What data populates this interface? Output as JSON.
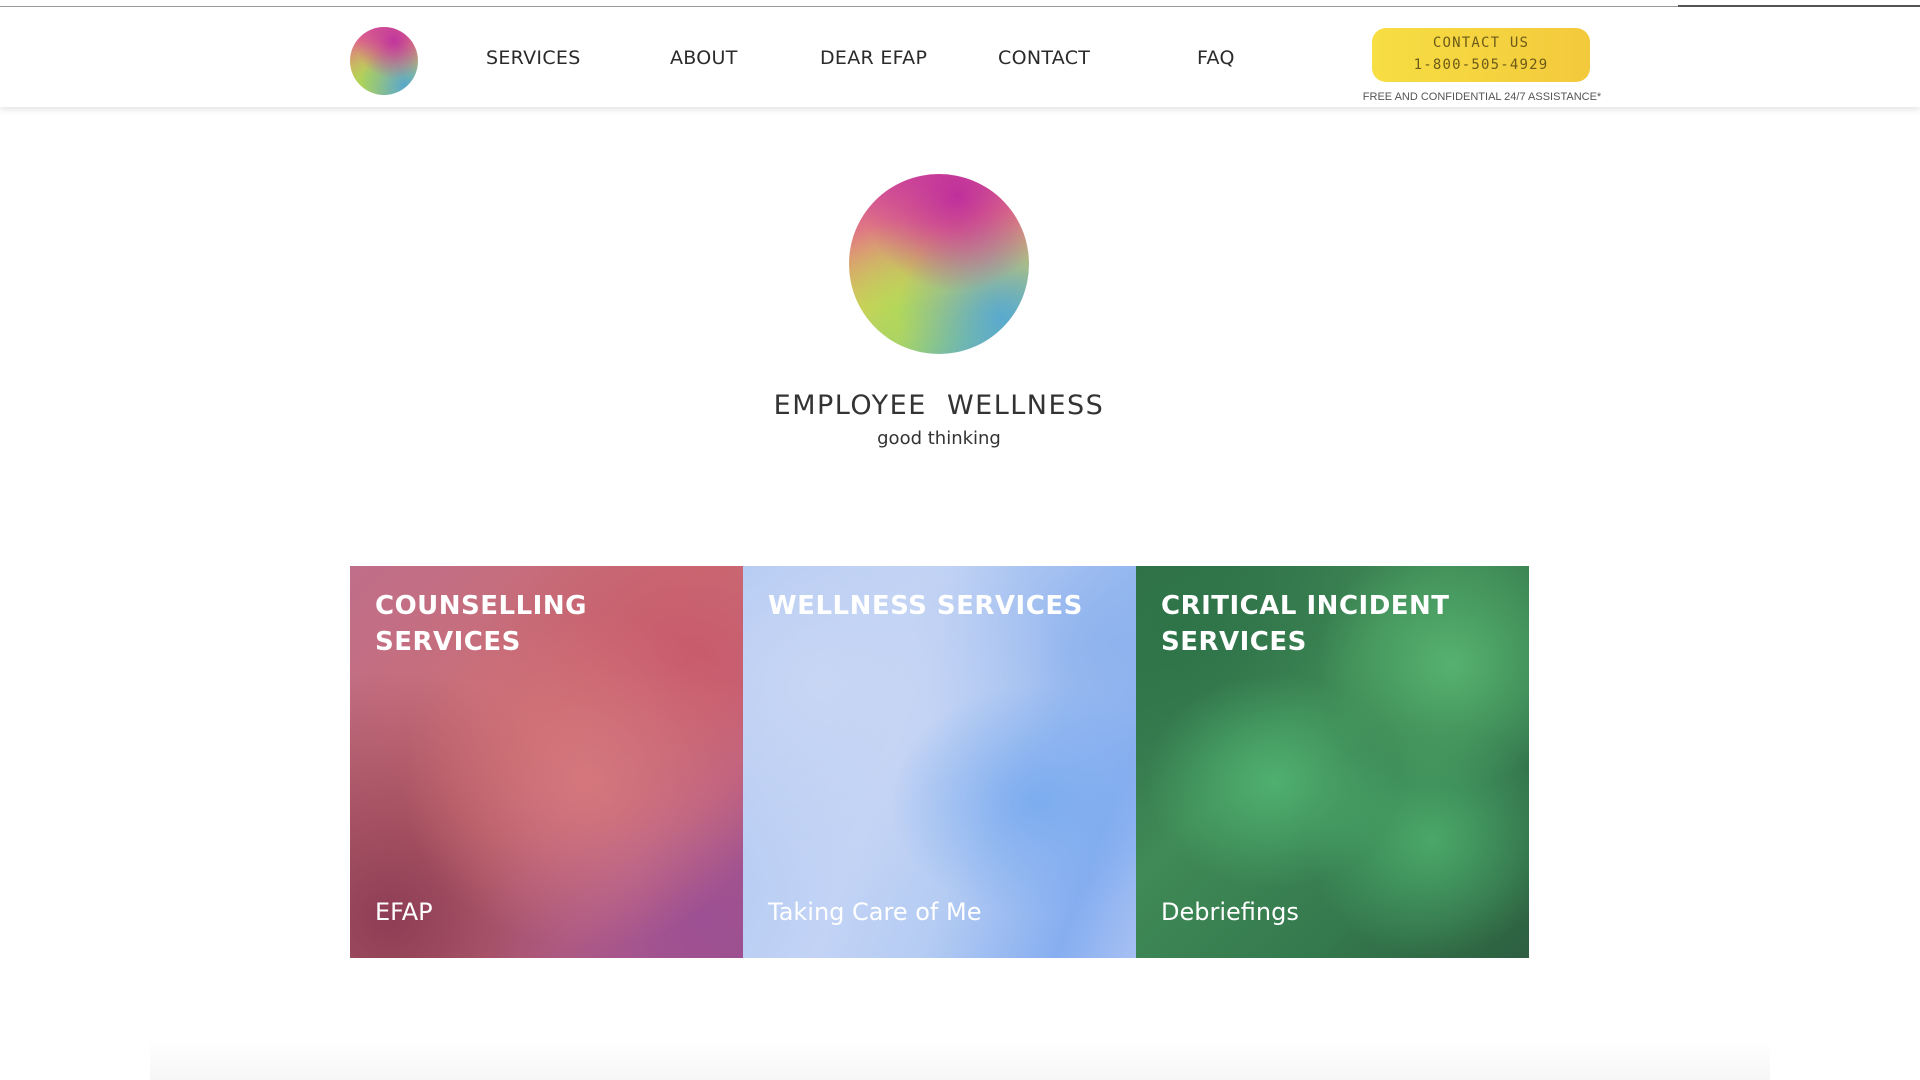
{
  "nav": {
    "items": [
      {
        "label": "SERVICES"
      },
      {
        "label": "ABOUT"
      },
      {
        "label": "DEAR EFAP"
      },
      {
        "label": "CONTACT"
      },
      {
        "label": "FAQ"
      }
    ],
    "cta": {
      "label": "CONTACT US",
      "phone": "1-800-505-4929",
      "note": "FREE AND CONFIDENTIAL 24/7 ASSISTANCE*"
    }
  },
  "hero": {
    "brand_name": "EMPLOYEE  WELLNESS",
    "tagline": "good thinking"
  },
  "cards": [
    {
      "title": "COUNSELLING SERVICES",
      "subtitle": "EFAP"
    },
    {
      "title": "WELLNESS SERVICES",
      "subtitle": "Taking Care of Me"
    },
    {
      "title": "CRITICAL INCIDENT SERVICES",
      "subtitle": "Debriefings"
    }
  ],
  "colors": {
    "cta_background": "#f5d33f",
    "card_counselling": "#c86d7c",
    "card_wellness": "#b5ccf3",
    "card_critical": "#3f8a56"
  }
}
